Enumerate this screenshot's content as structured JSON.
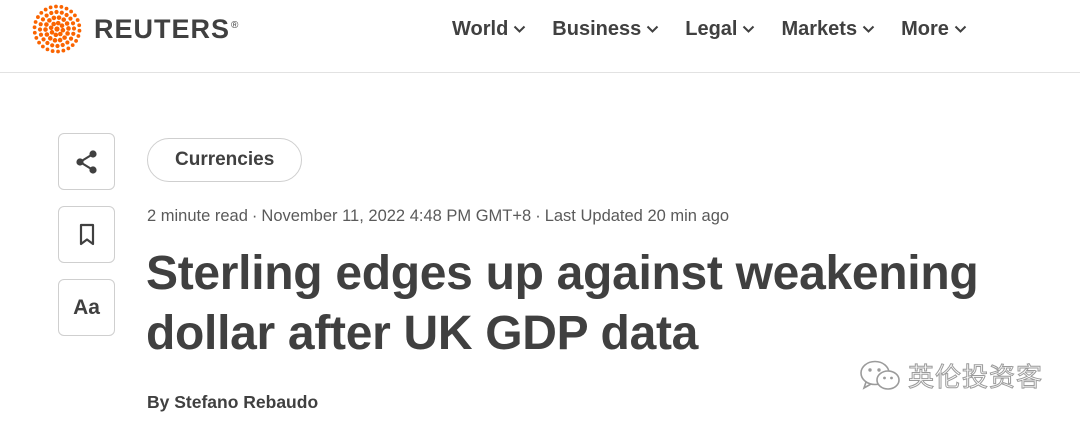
{
  "brand": {
    "name": "REUTERS",
    "registered": "®",
    "logo_icon": "reuters-dot-logo"
  },
  "nav": {
    "items": [
      {
        "label": "World"
      },
      {
        "label": "Business"
      },
      {
        "label": "Legal"
      },
      {
        "label": "Markets"
      },
      {
        "label": "More"
      }
    ]
  },
  "side_tools": {
    "share_icon": "share-icon",
    "bookmark_icon": "bookmark-icon",
    "text_size_label": "Aa"
  },
  "article": {
    "category": "Currencies",
    "read_time": "2 minute read",
    "published": "November 11, 2022 4:48 PM GMT+8",
    "updated": "Last Updated 20 min ago",
    "separator": "·",
    "headline_line1": "Sterling edges up against weakening",
    "headline_line2": "dollar after UK GDP data",
    "byline": "By Stefano Rebaudo"
  },
  "watermark": {
    "text": "英伦投资客",
    "icon": "wechat-icon"
  },
  "colors": {
    "text": "#404040",
    "logo_orange": "#fa6400",
    "border": "#cfcfcf"
  }
}
